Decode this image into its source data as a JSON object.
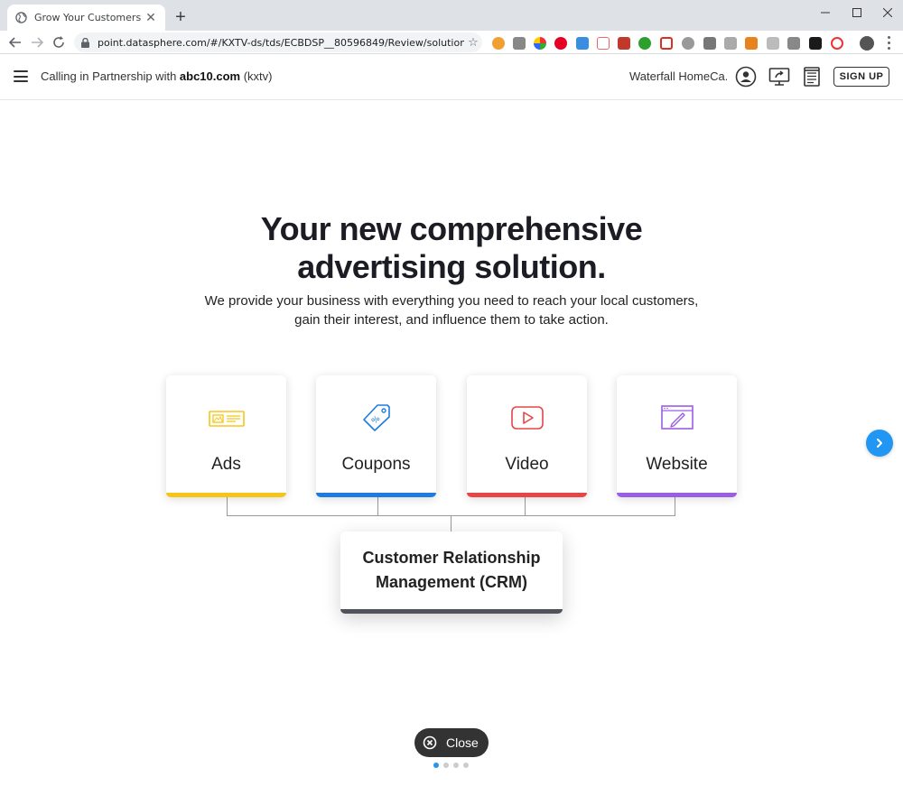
{
  "browser": {
    "tab_title": "Grow Your Customers",
    "tab_close": "✕",
    "new_tab": "+",
    "url": "point.datasphere.com/#/KXTV-ds/tds/ECBDSP__80596849/Review/solution",
    "window_controls": [
      "minimize-icon",
      "maximize-icon",
      "close-icon"
    ]
  },
  "header": {
    "partner_prefix": "Calling in Partnership with ",
    "partner_domain": "abc10.com",
    "partner_suffix": " (kxtv)",
    "business_name": "Waterfall HomeCa...",
    "signup_label": "SIGN UP"
  },
  "hero": {
    "headline_line1": "Your new comprehensive",
    "headline_line2": "advertising solution.",
    "subtitle_line1": "We provide your business with everything you need to reach your local customers,",
    "subtitle_line2": "gain their interest, and influence them to take action."
  },
  "cards": [
    {
      "label": "Ads",
      "icon": "ad-icon",
      "color": "#f5c518"
    },
    {
      "label": "Coupons",
      "icon": "coupon-tag-icon",
      "color": "#1e7be0"
    },
    {
      "label": "Video",
      "icon": "video-play-icon",
      "color": "#e84545"
    },
    {
      "label": "Website",
      "icon": "website-icon",
      "color": "#9b5de5"
    }
  ],
  "crm": {
    "line1": "Customer Relationship",
    "line2": "Management (CRM)"
  },
  "close_label": "Close",
  "pagination": {
    "total": 4,
    "current": 1
  }
}
